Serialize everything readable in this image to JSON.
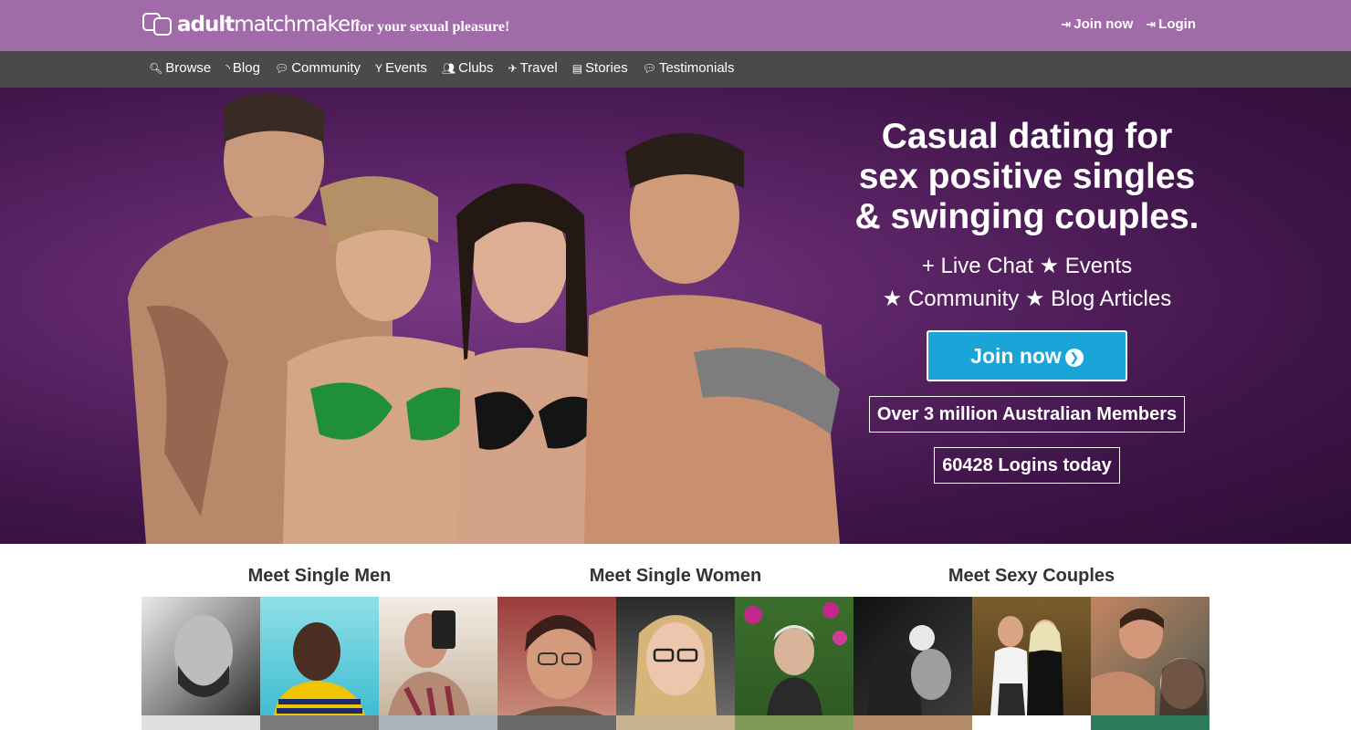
{
  "header": {
    "logo_word_bold": "adult",
    "logo_word_light": "matchmaker",
    "tagline": "for your sexual pleasure!",
    "join_label": "Join now",
    "login_label": "Login"
  },
  "nav": {
    "items": [
      {
        "icon": "search-icon",
        "label": "Browse"
      },
      {
        "icon": "rss-icon",
        "label": "Blog"
      },
      {
        "icon": "comments-icon",
        "label": "Community"
      },
      {
        "icon": "cocktail-icon",
        "label": "Events"
      },
      {
        "icon": "users-icon",
        "label": "Clubs"
      },
      {
        "icon": "plane-icon",
        "label": "Travel"
      },
      {
        "icon": "book-icon",
        "label": "Stories"
      },
      {
        "icon": "comment-icon",
        "label": "Testimonials"
      }
    ]
  },
  "hero": {
    "headline": "Casual dating for sex positive singles & swinging couples.",
    "features_line1": "+ Live Chat  ★ Events",
    "features_line2": "★ Community  ★ Blog Articles",
    "cta_label": "Join now",
    "members_stat": "Over 3 million Australian Members",
    "logins_stat": "60428 Logins today"
  },
  "meet": {
    "men_title": "Meet Single Men",
    "women_title": "Meet Single Women",
    "couples_title": "Meet Sexy Couples"
  },
  "colors": {
    "header_bg": "#a16aa8",
    "nav_bg": "#4a4a4a",
    "hero_bg": "#5b2466",
    "cta_bg": "#1ba4d8"
  }
}
